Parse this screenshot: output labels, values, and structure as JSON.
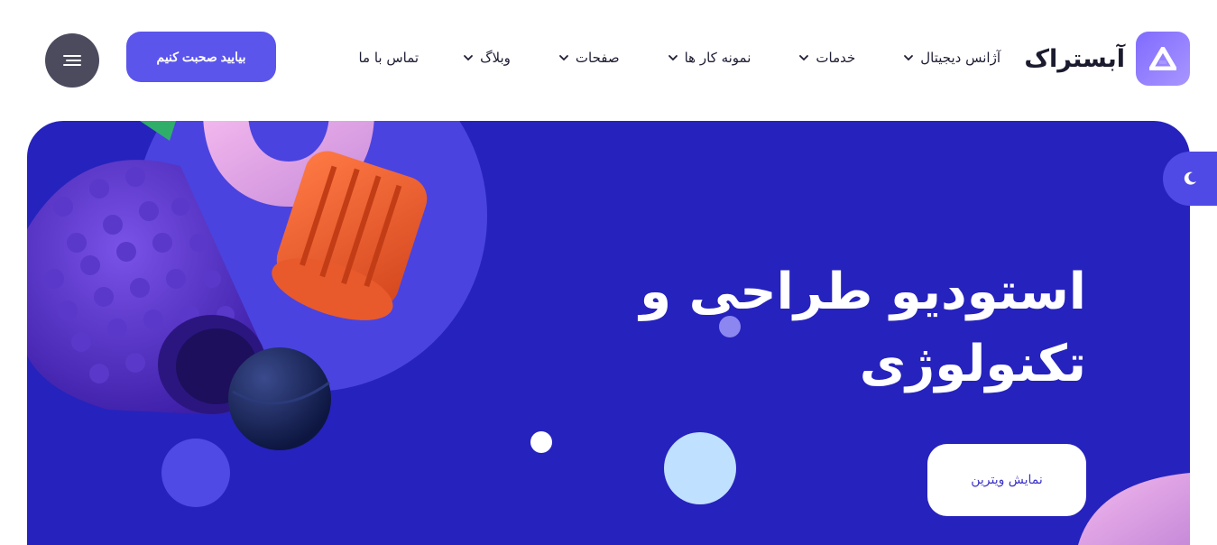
{
  "brand": {
    "name": "آبستراک",
    "logo_icon": "triangle-a-icon"
  },
  "nav": {
    "items": [
      {
        "label": "آژانس دیجیتال",
        "has_dropdown": true
      },
      {
        "label": "خدمات",
        "has_dropdown": true
      },
      {
        "label": "نمونه کار ها",
        "has_dropdown": true
      },
      {
        "label": "صفحات",
        "has_dropdown": true
      },
      {
        "label": "وبلاگ",
        "has_dropdown": true
      },
      {
        "label": "تماس با ما",
        "has_dropdown": false
      }
    ]
  },
  "cta": {
    "label": "بیایید صحبت کنیم"
  },
  "menu_button": {
    "icon": "hamburger-icon"
  },
  "hero": {
    "title_line1": "استودیو طراحی و",
    "title_line2": "تکنولوژی",
    "button_label": "نمایش ویترین"
  },
  "theme_toggle": {
    "icon": "moon-icon"
  },
  "colors": {
    "accent": "#5b55ec",
    "hero_bg": "#2622bd",
    "dark_button": "#4b4b5d"
  }
}
